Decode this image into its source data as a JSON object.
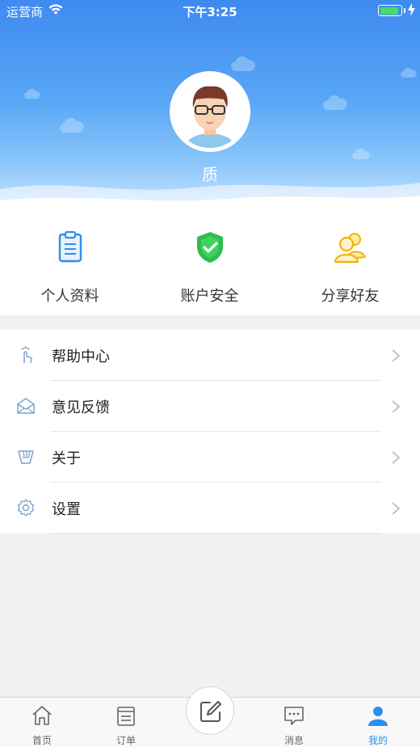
{
  "status_bar": {
    "carrier": "运营商",
    "time": "下午3:25"
  },
  "profile": {
    "username": "质"
  },
  "quick_actions": [
    {
      "label": "个人资料",
      "icon": "clipboard-icon",
      "color": "#2d8ff0"
    },
    {
      "label": "账户安全",
      "icon": "shield-check-icon",
      "color": "#2dbd4e"
    },
    {
      "label": "分享好友",
      "icon": "users-icon",
      "color": "#f5b400"
    }
  ],
  "menu": [
    {
      "label": "帮助中心",
      "icon": "tap-hand-icon"
    },
    {
      "label": "意见反馈",
      "icon": "envelope-icon"
    },
    {
      "label": "关于",
      "icon": "info-icon"
    },
    {
      "label": "设置",
      "icon": "gear-icon"
    }
  ],
  "tabbar": {
    "tabs": [
      {
        "label": "首页",
        "icon": "home-icon"
      },
      {
        "label": "订单",
        "icon": "order-list-icon"
      },
      {
        "label": "消息",
        "icon": "message-icon"
      },
      {
        "label": "我的",
        "icon": "user-icon",
        "active": true
      }
    ],
    "center_icon": "compose-icon"
  },
  "colors": {
    "accent": "#2d8ff0",
    "header_top": "#3e8af0"
  }
}
